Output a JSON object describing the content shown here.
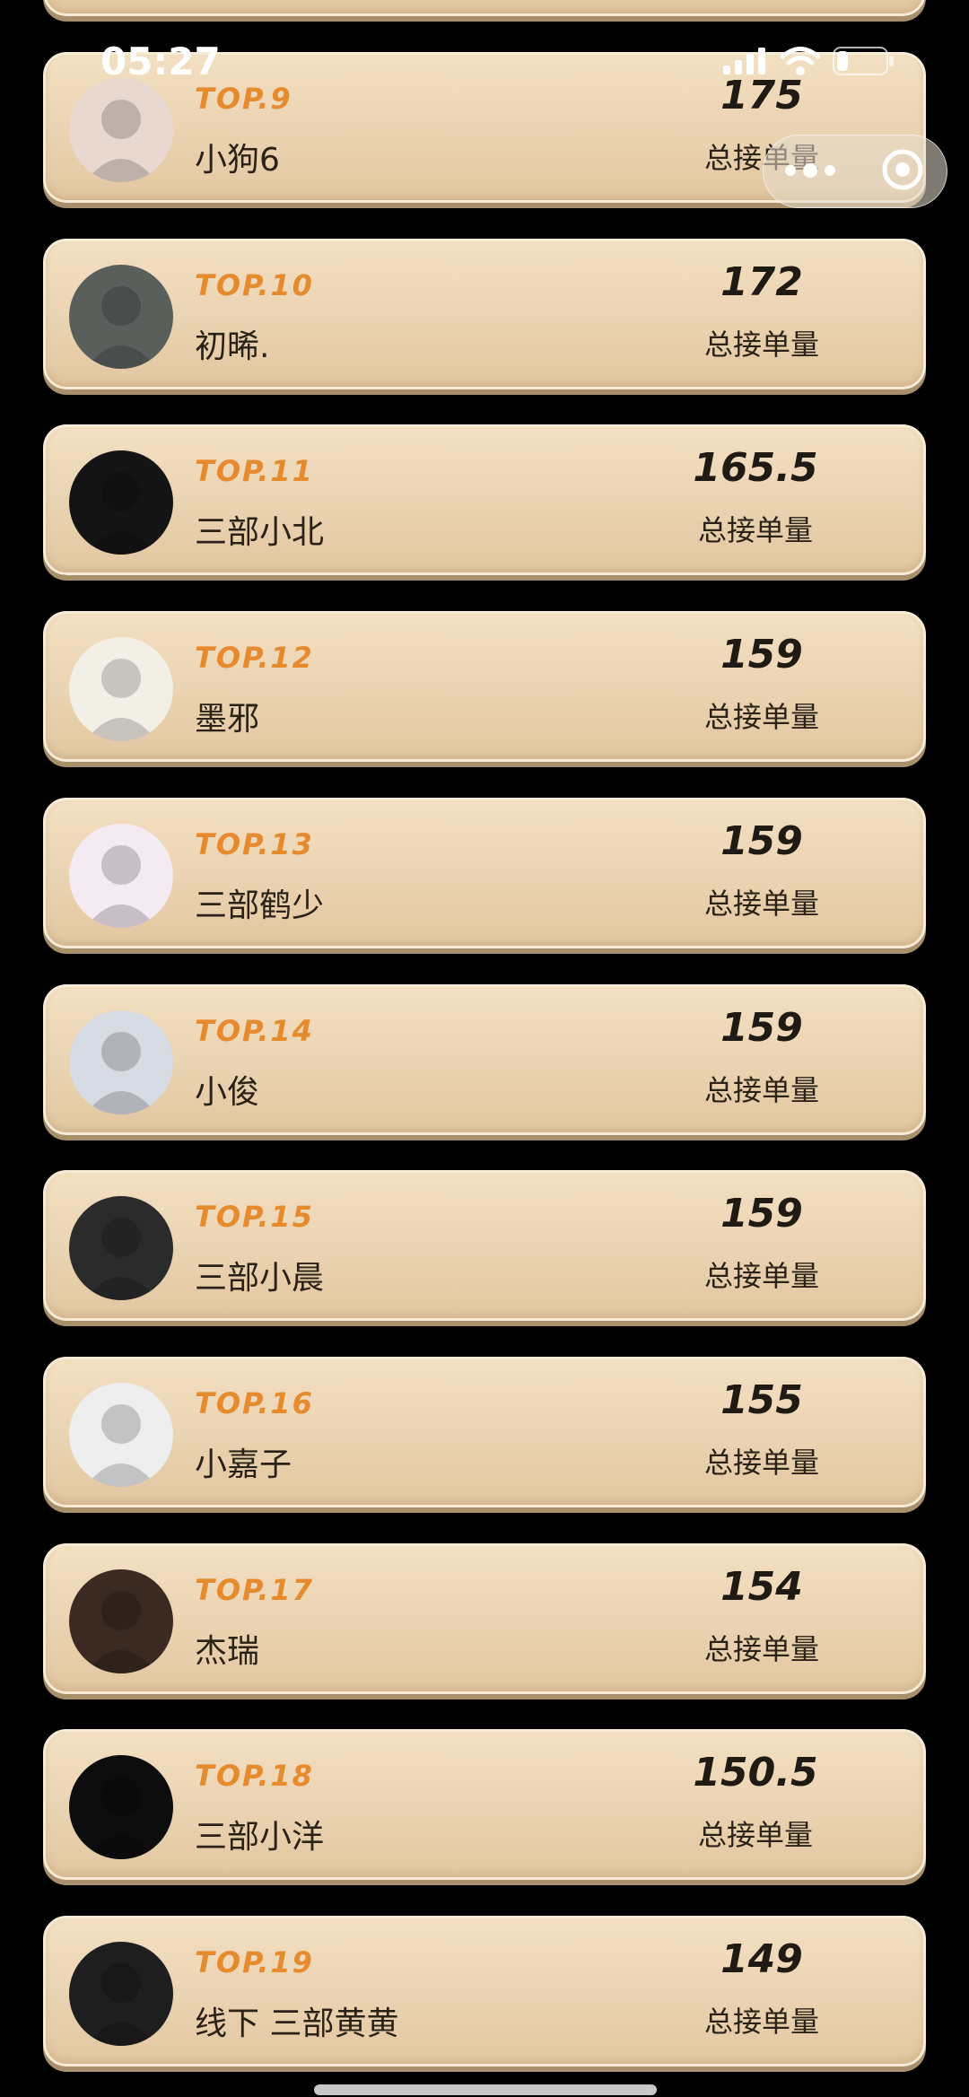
{
  "status_bar": {
    "time": "05:27"
  },
  "score_label": "总接单量",
  "entries": [
    {
      "rank": "TOP.9",
      "name": "小狗6",
      "score": "175",
      "avatar_color": "#e8d8d0"
    },
    {
      "rank": "TOP.10",
      "name": "初晞.",
      "score": "172",
      "avatar_color": "#5a5f5c"
    },
    {
      "rank": "TOP.11",
      "name": "三部小北",
      "score": "165.5",
      "avatar_color": "#141414"
    },
    {
      "rank": "TOP.12",
      "name": "墨邪",
      "score": "159",
      "avatar_color": "#f2efe6"
    },
    {
      "rank": "TOP.13",
      "name": "三部鹤少",
      "score": "159",
      "avatar_color": "#f4eaf2"
    },
    {
      "rank": "TOP.14",
      "name": "小俊",
      "score": "159",
      "avatar_color": "#d7dbe3"
    },
    {
      "rank": "TOP.15",
      "name": "三部小晨",
      "score": "159",
      "avatar_color": "#2b2b2b"
    },
    {
      "rank": "TOP.16",
      "name": "小嘉子",
      "score": "155",
      "avatar_color": "#eeeeee"
    },
    {
      "rank": "TOP.17",
      "name": "杰瑞",
      "score": "154",
      "avatar_color": "#3a2a22"
    },
    {
      "rank": "TOP.18",
      "name": "三部小洋",
      "score": "150.5",
      "avatar_color": "#0d0d0d"
    },
    {
      "rank": "TOP.19",
      "name": "线下 三部黄黄",
      "score": "149",
      "avatar_color": "#1e1e1e"
    }
  ]
}
